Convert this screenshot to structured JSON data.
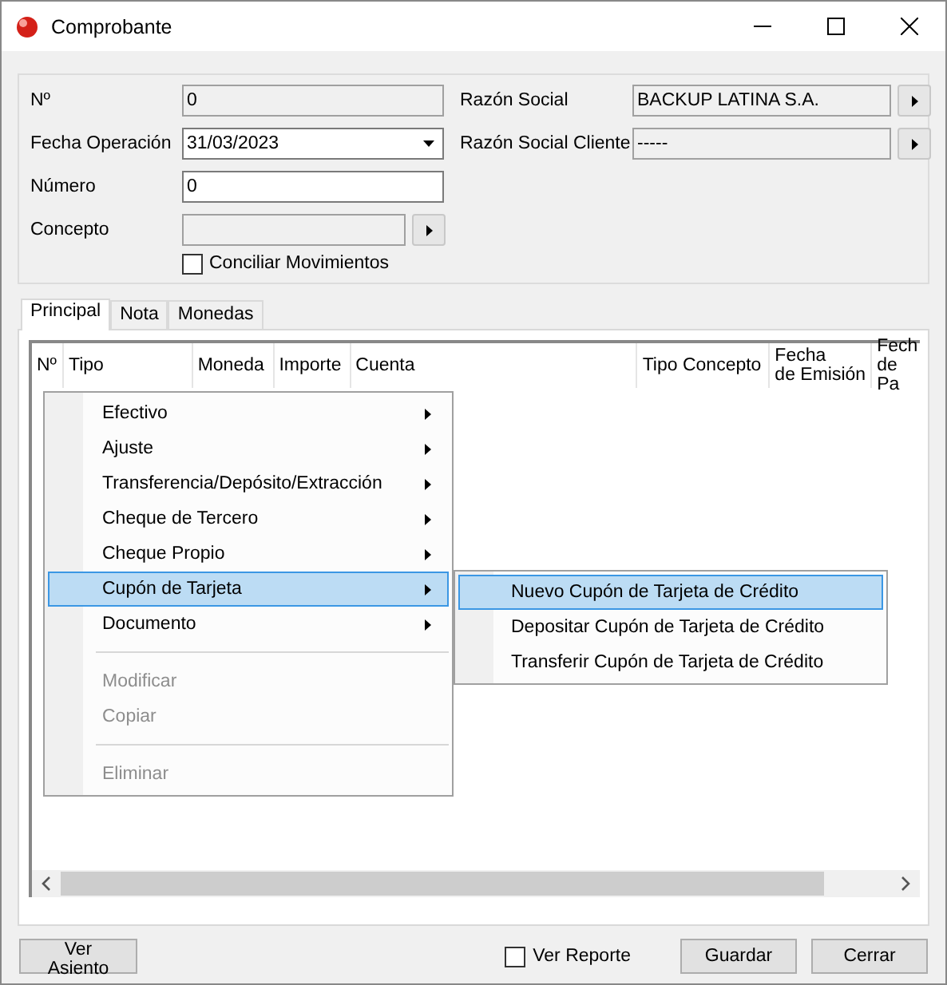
{
  "window": {
    "title": "Comprobante"
  },
  "form": {
    "left": [
      {
        "kind": "text",
        "label": "Nº",
        "value": "0",
        "disabled": true
      },
      {
        "kind": "dropdown",
        "label": "Fecha Operación",
        "value": "31/03/2023",
        "disabled": false
      },
      {
        "kind": "text",
        "label": "Número",
        "value": "0",
        "disabled": false
      },
      {
        "kind": "picker",
        "label": "Concepto",
        "disabled": true
      }
    ],
    "conciliar": {
      "label": "Conciliar Movimientos",
      "checked": false
    },
    "right": [
      {
        "kind": "picker",
        "label": "Razón Social",
        "value": "BACKUP LATINA S.A.",
        "disabled": true
      },
      {
        "kind": "picker",
        "label": "Razón Social Cliente",
        "value": "-----",
        "disabled": true
      }
    ]
  },
  "tabs": [
    {
      "label": "Principal",
      "selected": true
    },
    {
      "label": "Nota",
      "selected": false
    },
    {
      "label": "Monedas",
      "selected": false
    }
  ],
  "table": {
    "columns": [
      "Nº",
      "Tipo",
      "Moneda",
      "Importe",
      "Cuenta",
      "Tipo Concepto",
      "Fecha\nde Emisión",
      "Fech\nde Pa"
    ]
  },
  "context_menu": {
    "items": [
      {
        "kind": "item",
        "label": "Efectivo",
        "submenu": true,
        "disabled": false,
        "selected": false
      },
      {
        "kind": "item",
        "label": "Ajuste",
        "submenu": true,
        "disabled": false,
        "selected": false
      },
      {
        "kind": "item",
        "label": "Transferencia/Depósito/Extracción",
        "submenu": true,
        "disabled": false,
        "selected": false
      },
      {
        "kind": "item",
        "label": "Cheque de Tercero",
        "submenu": true,
        "disabled": false,
        "selected": false
      },
      {
        "kind": "item",
        "label": "Cheque Propio",
        "submenu": true,
        "disabled": false,
        "selected": false
      },
      {
        "kind": "item",
        "label": "Cupón de Tarjeta",
        "submenu": true,
        "disabled": false,
        "selected": true
      },
      {
        "kind": "item",
        "label": "Documento",
        "submenu": true,
        "disabled": false,
        "selected": false
      },
      {
        "kind": "separator"
      },
      {
        "kind": "item",
        "label": "Modificar",
        "submenu": false,
        "disabled": true,
        "selected": false
      },
      {
        "kind": "item",
        "label": "Copiar",
        "submenu": false,
        "disabled": true,
        "selected": false
      },
      {
        "kind": "separator"
      },
      {
        "kind": "item",
        "label": "Eliminar",
        "submenu": false,
        "disabled": true,
        "selected": false
      }
    ],
    "submenu": [
      {
        "label": "Nuevo Cupón de Tarjeta de Crédito",
        "selected": true
      },
      {
        "label": "Depositar Cupón de Tarjeta de Crédito",
        "selected": false
      },
      {
        "label": "Transferir Cupón de Tarjeta de Crédito",
        "selected": false
      }
    ]
  },
  "footer": {
    "left_button": "Ver Asiento",
    "ver_reporte": {
      "label": "Ver Reporte",
      "checked": false
    },
    "buttons": [
      "Guardar",
      "Cerrar"
    ]
  }
}
